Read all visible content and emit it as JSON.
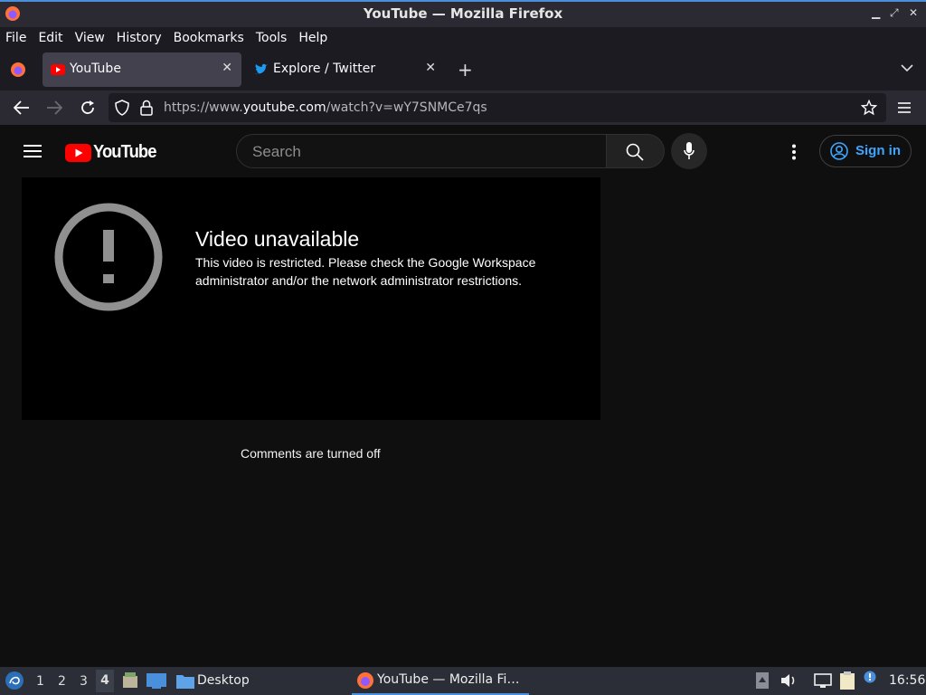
{
  "window": {
    "title": "YouTube — Mozilla Firefox"
  },
  "menu": [
    "File",
    "Edit",
    "View",
    "History",
    "Bookmarks",
    "Tools",
    "Help"
  ],
  "tabs": [
    {
      "label": "YouTube",
      "active": true
    },
    {
      "label": "Explore / Twitter",
      "active": false
    }
  ],
  "address": {
    "prefix": "https://www.",
    "domain": "youtube.com",
    "path": "/watch?v=wY7SNMCe7qs"
  },
  "youtube": {
    "logo_text": "YouTube",
    "search_placeholder": "Search",
    "signin_label": "Sign in",
    "error_title": "Video unavailable",
    "error_message": "This video is restricted. Please check the Google Workspace administrator and/or the network administrator restrictions.",
    "comments_text": "Comments are turned off"
  },
  "taskbar": {
    "workspaces": [
      "1",
      "2",
      "3",
      "4"
    ],
    "active_workspace": "4",
    "desktop_label": "Desktop",
    "firefox_task": "YouTube — Mozilla Fi…",
    "clock": "16:56"
  },
  "colors": {
    "yt_red": "#ff0000",
    "link_blue": "#3ea6ff",
    "accent": "#4a8fdc"
  }
}
